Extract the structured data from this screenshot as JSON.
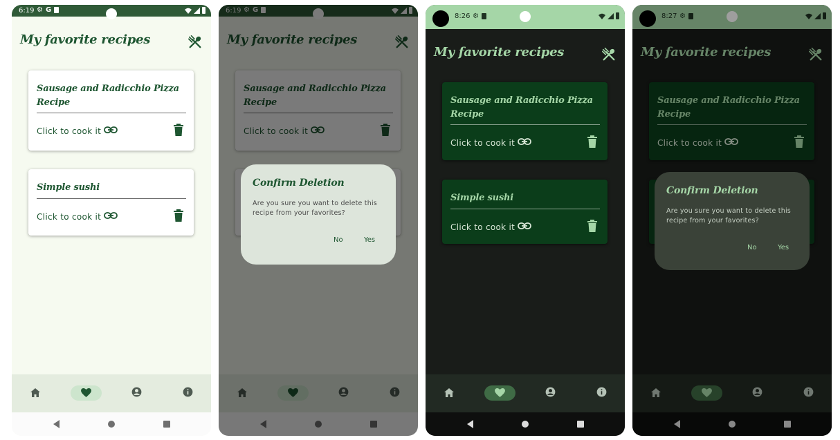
{
  "app": {
    "title": "My favorite recipes",
    "title_icon": "utensils-icon"
  },
  "recipes": [
    {
      "name": "Sausage and Radicchio Pizza Recipe",
      "action_label": "Click to cook it",
      "link_icon": "link-icon",
      "delete_icon": "trash-icon"
    },
    {
      "name": "Simple sushi",
      "action_label": "Click to cook it",
      "link_icon": "link-icon",
      "delete_icon": "trash-icon"
    }
  ],
  "dialog": {
    "title": "Confirm Deletion",
    "message": "Are you sure you want to delete this recipe from your favorites?",
    "no_label": "No",
    "yes_label": "Yes"
  },
  "bottom_nav": [
    {
      "icon": "home-icon",
      "selected": false
    },
    {
      "icon": "heart-icon",
      "selected": true
    },
    {
      "icon": "account-icon",
      "selected": false
    },
    {
      "icon": "info-icon",
      "selected": false
    }
  ],
  "screens": [
    {
      "theme": "light",
      "dialog_open": false,
      "status_time": "6:19"
    },
    {
      "theme": "light",
      "dialog_open": true,
      "status_time": "6:19"
    },
    {
      "theme": "dark",
      "dialog_open": false,
      "status_time": "8:26"
    },
    {
      "theme": "dark",
      "dialog_open": true,
      "status_time": "8:27"
    }
  ],
  "colors": {
    "light_background": "#f6faf0",
    "light_primary": "#1e5631",
    "light_card": "#ffffff",
    "light_nav": "#e4ecdf",
    "light_pill": "#cde5cd",
    "light_dialog": "#dde5db",
    "dark_background": "#191c19",
    "dark_status": "#a5d6a7",
    "dark_primary": "#a5d6a7",
    "dark_card": "#0b3d1a",
    "dark_nav": "#222a23",
    "dark_pill": "#3f6b45",
    "dark_dialog": "#3a4238"
  }
}
